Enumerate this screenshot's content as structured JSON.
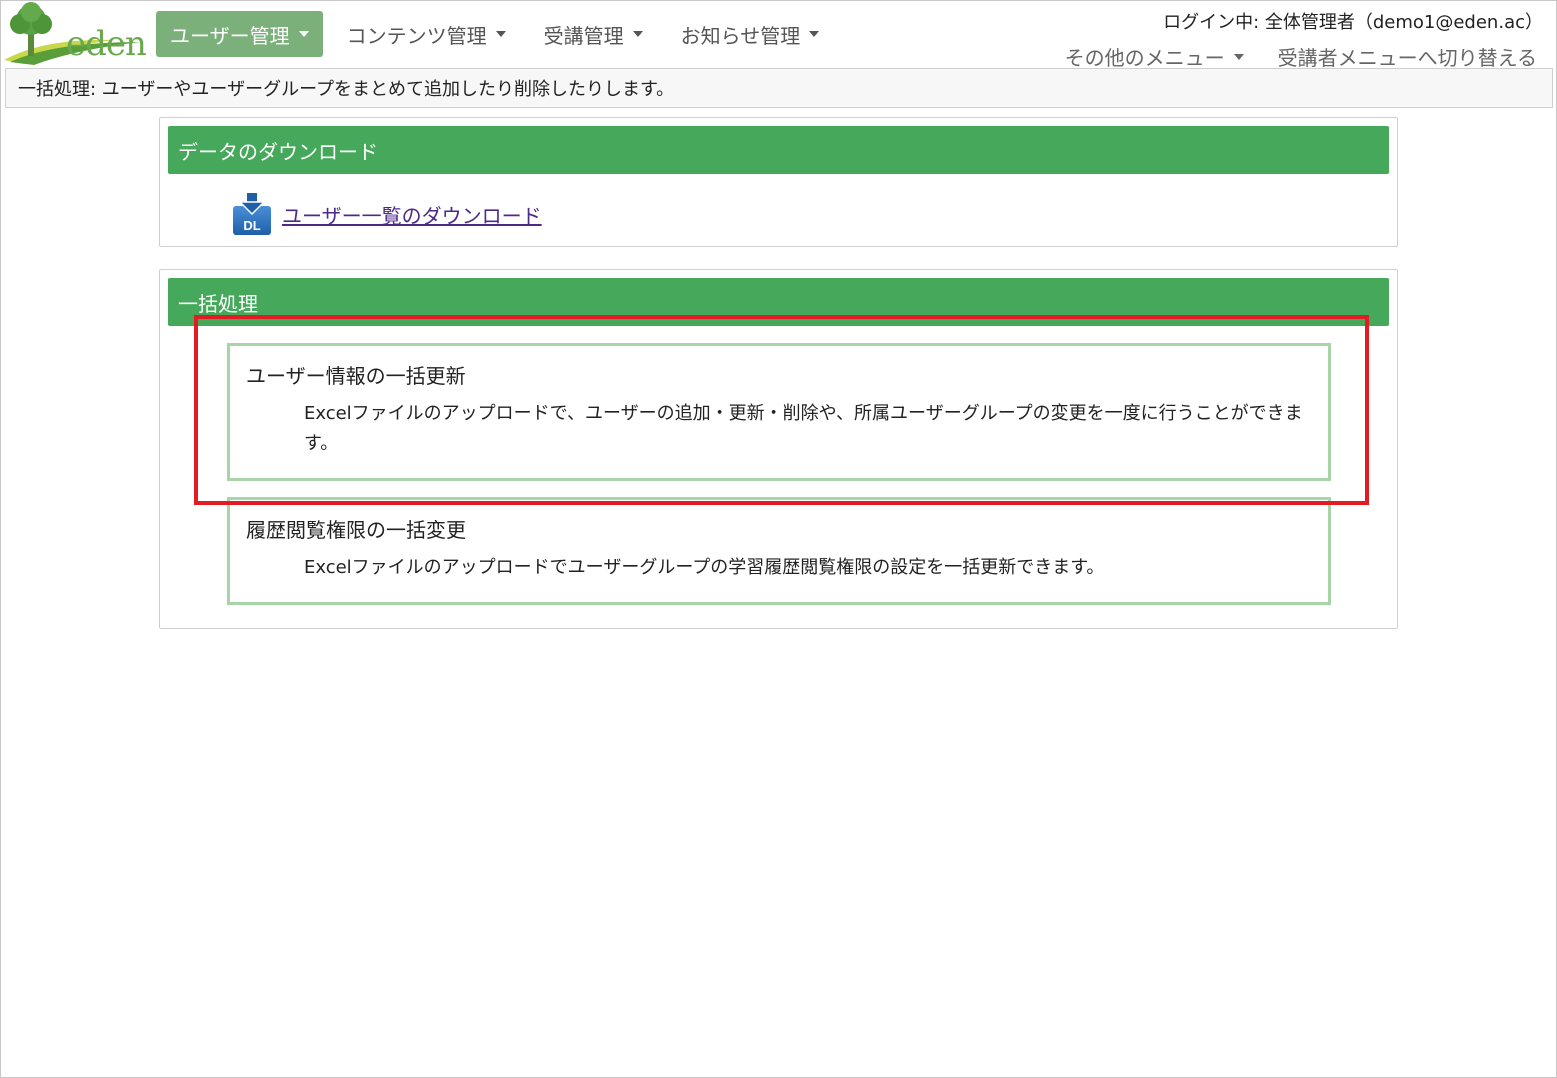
{
  "logo": {
    "text": "eden",
    "icon": "tree-icon"
  },
  "nav": {
    "items": [
      {
        "label": "ユーザー管理",
        "active": true
      },
      {
        "label": "コンテンツ管理",
        "active": false
      },
      {
        "label": "受講管理",
        "active": false
      },
      {
        "label": "お知らせ管理",
        "active": false
      }
    ]
  },
  "header": {
    "login_text": "ログイン中: 全体管理者（demo1@eden.ac）",
    "other_menu": "その他のメニュー",
    "switch_menu": "受講者メニューへ切り替える"
  },
  "info_bar": {
    "text": "一括処理: ユーザーやユーザーグループをまとめて追加したり削除したりします。"
  },
  "download_panel": {
    "title": "データのダウンロード",
    "icon": "download-dl-icon",
    "icon_text": "DL",
    "link": "ユーザー一覧のダウンロード"
  },
  "batch_panel": {
    "title": "一括処理",
    "operations": [
      {
        "title": "ユーザー情報の一括更新",
        "desc": "Excelファイルのアップロードで、ユーザーの追加・更新・削除や、所属ユーザーグループの変更を一度に行うことができます。"
      },
      {
        "title": "履歴閲覧権限の一括変更",
        "desc": "Excelファイルのアップロードでユーザーグループの学習履歴閲覧権限の設定を一括更新できます。"
      }
    ]
  },
  "colors": {
    "brand_green": "#45a85a",
    "nav_active": "#7bb07b",
    "box_border": "#a8d5a8",
    "highlight": "#e31b23",
    "link": "#4b2a8a"
  }
}
